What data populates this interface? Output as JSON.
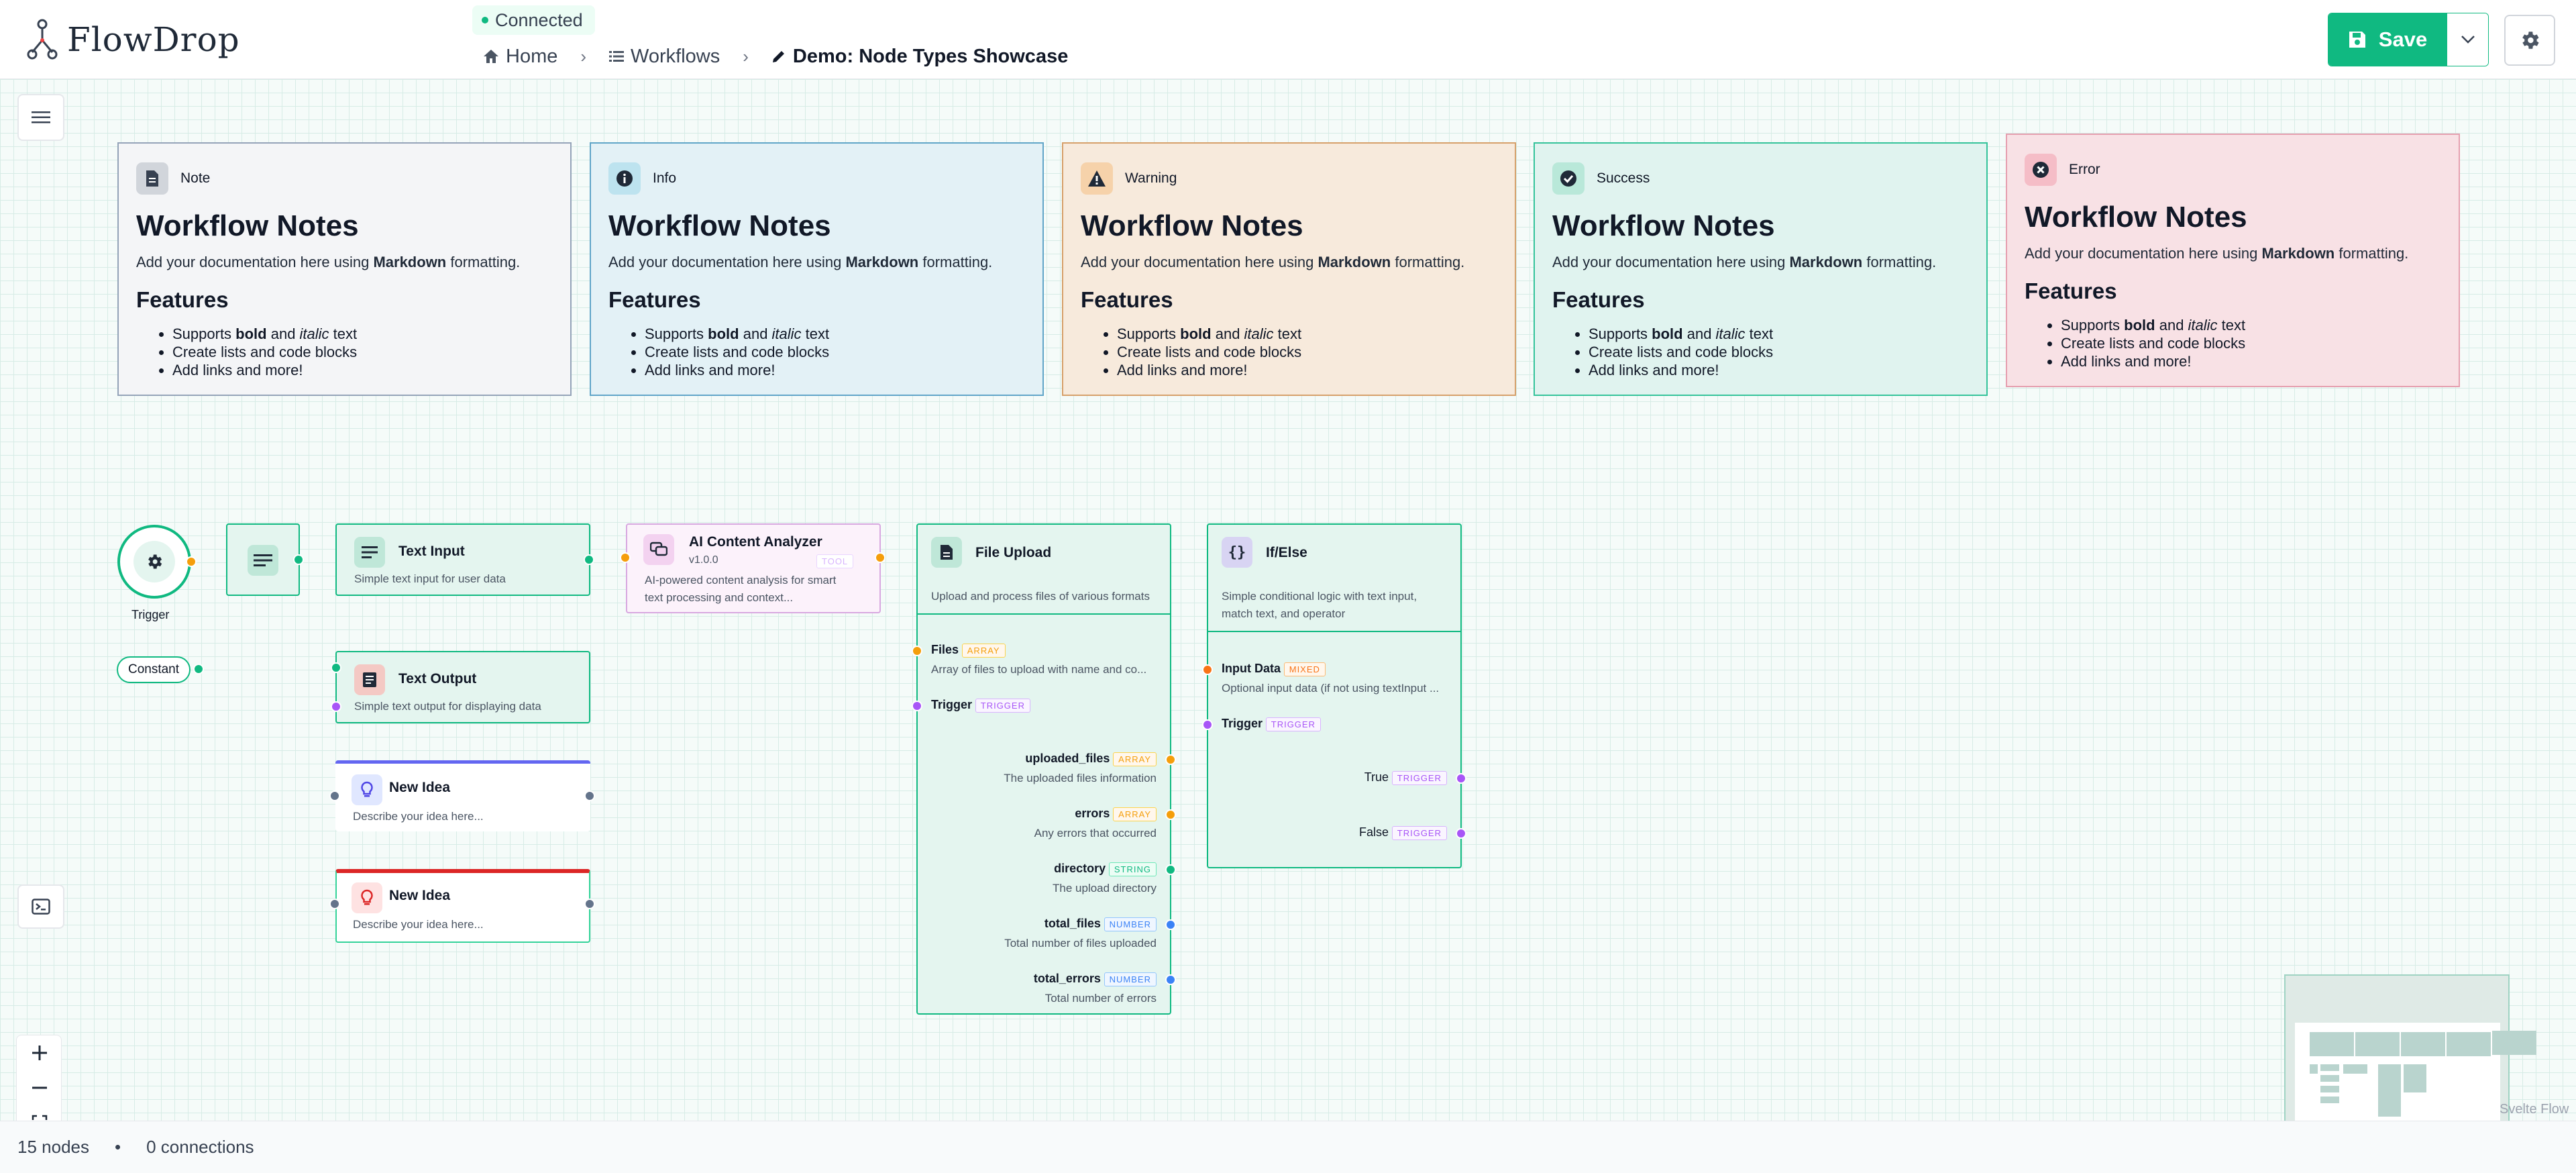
{
  "app": {
    "name": "FlowDrop",
    "status": "Connected"
  },
  "breadcrumbs": [
    {
      "label": "Home"
    },
    {
      "label": "Workflows"
    },
    {
      "label": "Demo: Node Types Showcase"
    }
  ],
  "toolbar": {
    "save_label": "Save"
  },
  "notes": [
    {
      "type": "Note",
      "title": "Workflow Notes",
      "intro_pre": "Add your documentation here using ",
      "intro_bold": "Markdown",
      "intro_post": " formatting.",
      "features": "Features",
      "b1_pre": "Supports ",
      "b1_bold": "bold",
      "b1_mid": " and ",
      "b1_ital": "italic",
      "b1_post": " text",
      "b2": "Create lists and code blocks",
      "b3": "Add links and more!",
      "bg": "#f4f5f7",
      "border": "#94a3b8",
      "icon_bg": "#d1d5db"
    },
    {
      "type": "Info",
      "title": "Workflow Notes",
      "intro_pre": "Add your documentation here using ",
      "intro_bold": "Markdown",
      "intro_post": " formatting.",
      "features": "Features",
      "b1_pre": "Supports ",
      "b1_bold": "bold",
      "b1_mid": " and ",
      "b1_ital": "italic",
      "b1_post": " text",
      "b2": "Create lists and code blocks",
      "b3": "Add links and more!",
      "bg": "#e3f1f6",
      "border": "#60a5c8",
      "icon_bg": "#bde3ef"
    },
    {
      "type": "Warning",
      "title": "Workflow Notes",
      "intro_pre": "Add your documentation here using ",
      "intro_bold": "Markdown",
      "intro_post": " formatting.",
      "features": "Features",
      "b1_pre": "Supports ",
      "b1_bold": "bold",
      "b1_mid": " and ",
      "b1_ital": "italic",
      "b1_post": " text",
      "b2": "Create lists and code blocks",
      "b3": "Add links and more!",
      "bg": "#f7eadc",
      "border": "#d6a06a",
      "icon_bg": "#f6d2aa"
    },
    {
      "type": "Success",
      "title": "Workflow Notes",
      "intro_pre": "Add your documentation here using ",
      "intro_bold": "Markdown",
      "intro_post": " formatting.",
      "features": "Features",
      "b1_pre": "Supports ",
      "b1_bold": "bold",
      "b1_mid": " and ",
      "b1_ital": "italic",
      "b1_post": " text",
      "b2": "Create lists and code blocks",
      "b3": "Add links and more!",
      "bg": "#e0f3ef",
      "border": "#34c39a",
      "icon_bg": "#b9e8d9"
    },
    {
      "type": "Error",
      "title": "Workflow Notes",
      "intro_pre": "Add your documentation here using ",
      "intro_bold": "Markdown",
      "intro_post": " formatting.",
      "features": "Features",
      "b1_pre": "Supports ",
      "b1_bold": "bold",
      "b1_mid": " and ",
      "b1_ital": "italic",
      "b1_post": " text",
      "b2": "Create lists and code blocks",
      "b3": "Add links and more!",
      "bg": "#f8e1e5",
      "border": "#e6a0b0",
      "icon_bg": "#f5bdc7"
    }
  ],
  "nodes": {
    "trigger": {
      "label": "Trigger"
    },
    "constant": {
      "label": "Constant"
    },
    "text_input": {
      "title": "Text Input",
      "desc": "Simple text input for user data"
    },
    "text_output": {
      "title": "Text Output",
      "desc": "Simple text output for displaying data"
    },
    "idea1": {
      "title": "New Idea",
      "desc": "Describe your idea here...",
      "accent": "#6366f1"
    },
    "idea2": {
      "title": "New Idea",
      "desc": "Describe your idea here...",
      "accent": "#dc2626"
    },
    "ai": {
      "title": "AI Content Analyzer",
      "version": "v1.0.0",
      "tag": "TOOL",
      "desc1": "AI-powered content analysis for smart",
      "desc2": "text processing and context..."
    },
    "file_upload": {
      "title": "File Upload",
      "desc": "Upload and process files of various formats",
      "inputs": [
        {
          "name": "Files",
          "type": "ARRAY",
          "desc": "Array of files to upload with name and co..."
        },
        {
          "name": "Trigger",
          "type": "TRIGGER",
          "desc": ""
        }
      ],
      "outputs": [
        {
          "name": "uploaded_files",
          "type": "ARRAY",
          "desc": "The uploaded files information"
        },
        {
          "name": "errors",
          "type": "ARRAY",
          "desc": "Any errors that occurred"
        },
        {
          "name": "directory",
          "type": "STRING",
          "desc": "The upload directory"
        },
        {
          "name": "total_files",
          "type": "NUMBER",
          "desc": "Total number of files uploaded"
        },
        {
          "name": "total_errors",
          "type": "NUMBER",
          "desc": "Total number of errors"
        }
      ]
    },
    "ifelse": {
      "title": "If/Else",
      "desc1": "Simple conditional logic with text input,",
      "desc2": "match text, and operator",
      "inputs": [
        {
          "name": "Input Data",
          "type": "MIXED",
          "desc": "Optional input data (if not using textInput ..."
        },
        {
          "name": "Trigger",
          "type": "TRIGGER",
          "desc": ""
        }
      ],
      "outputs": [
        {
          "name": "True",
          "type": "TRIGGER"
        },
        {
          "name": "False",
          "type": "TRIGGER"
        }
      ]
    }
  },
  "status": {
    "nodes": "15 nodes",
    "connections": "0 connections"
  },
  "attribution": "Svelte Flow"
}
